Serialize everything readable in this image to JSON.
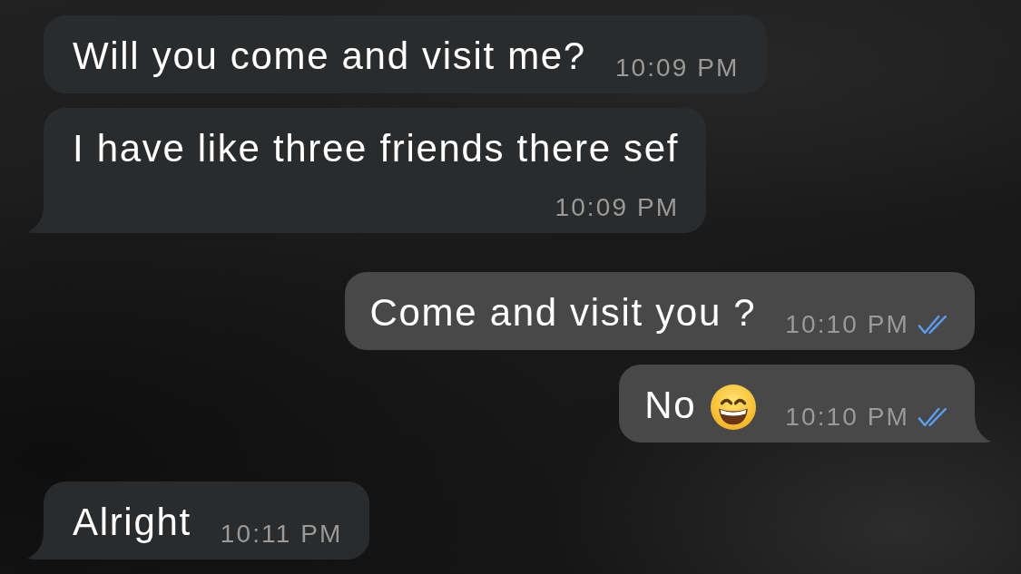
{
  "messages": [
    {
      "kind": "incoming",
      "text": "Will you come and visit me?",
      "time": "10:09 PM",
      "tail": false
    },
    {
      "kind": "incoming",
      "text": "I have like three friends there sef",
      "time": "10:09 PM",
      "tail": true
    },
    {
      "kind": "outgoing",
      "text": "Come and visit you ?",
      "time": "10:10 PM",
      "tail": false,
      "read": true
    },
    {
      "kind": "outgoing",
      "text": "No",
      "emoji": true,
      "time": "10:10 PM",
      "tail": true,
      "read": true
    },
    {
      "kind": "incoming",
      "text": "Alright",
      "time": "10:11 PM",
      "tail": true
    }
  ]
}
